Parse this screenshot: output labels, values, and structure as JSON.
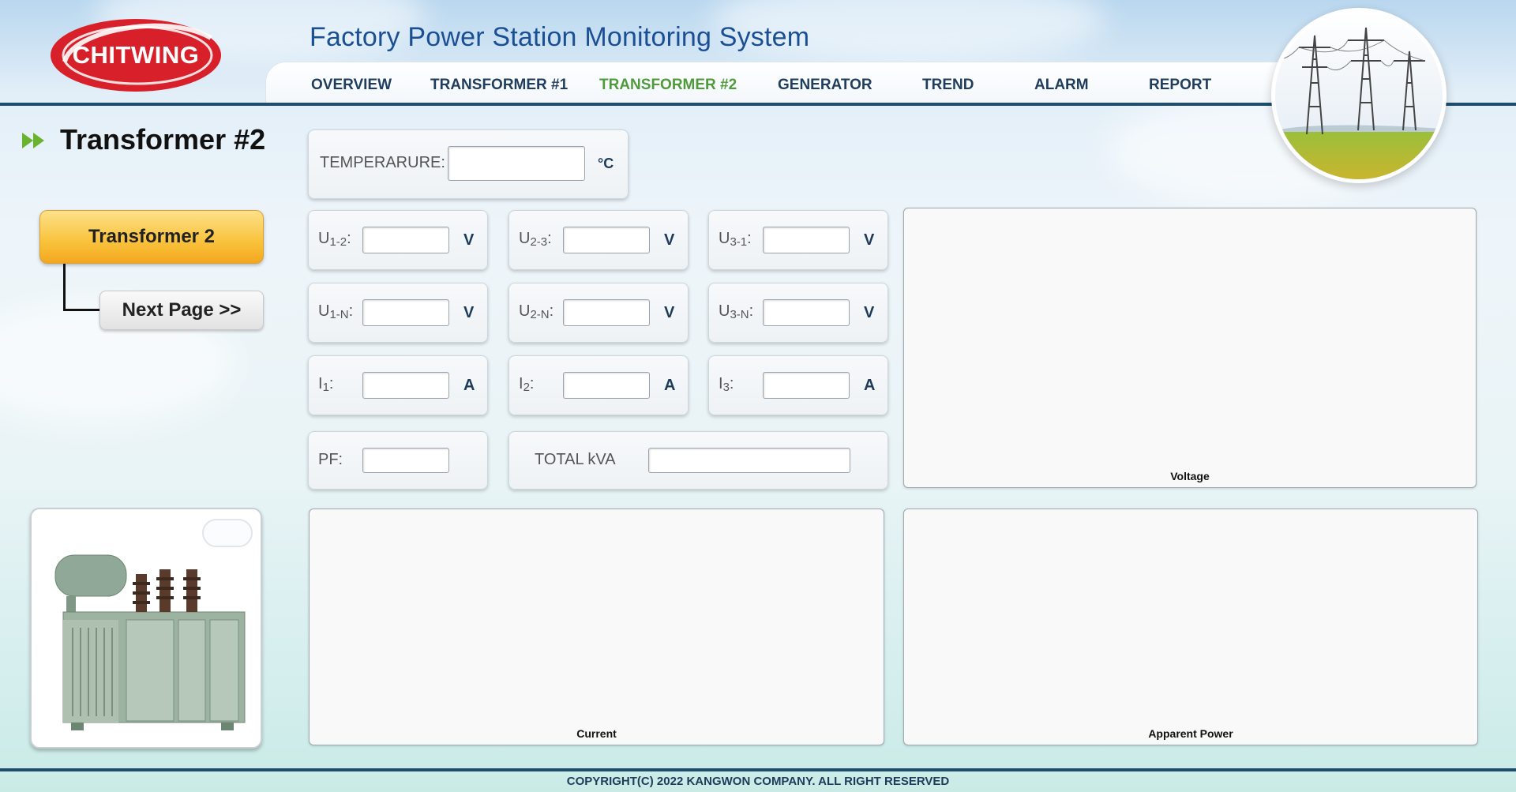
{
  "brand": {
    "logo_text": "CHITWING",
    "logo_color": "#d8202a"
  },
  "header": {
    "title": "Factory Power Station Monitoring System"
  },
  "nav": {
    "items": [
      {
        "label": "OVERVIEW"
      },
      {
        "label": "TRANSFORMER #1"
      },
      {
        "label": "TRANSFORMER #2",
        "active": true
      },
      {
        "label": "GENERATOR"
      },
      {
        "label": "TREND"
      },
      {
        "label": "ALARM"
      },
      {
        "label": "REPORT"
      }
    ],
    "active_color": "#4f9a3c"
  },
  "page": {
    "title": "Transformer #2",
    "transformer_button": "Transformer 2",
    "next_button": "Next Page >>"
  },
  "readings": {
    "temperature": {
      "label": "TEMPERARURE:",
      "unit": "°C",
      "value": ""
    },
    "u12": {
      "label_main": "U",
      "label_sub": "1-2",
      "label_suffix": ":",
      "unit": "V",
      "value": ""
    },
    "u23": {
      "label_main": "U",
      "label_sub": "2-3",
      "label_suffix": ":",
      "unit": "V",
      "value": ""
    },
    "u31": {
      "label_main": "U",
      "label_sub": "3-1",
      "label_suffix": ":",
      "unit": "V",
      "value": ""
    },
    "u1n": {
      "label_main": "U",
      "label_sub": "1-N",
      "label_suffix": ":",
      "unit": "V",
      "value": ""
    },
    "u2n": {
      "label_main": "U",
      "label_sub": "2-N",
      "label_suffix": ":",
      "unit": "V",
      "value": ""
    },
    "u3n": {
      "label_main": "U",
      "label_sub": "3-N",
      "label_suffix": ":",
      "unit": "V",
      "value": ""
    },
    "i1": {
      "label_main": "I",
      "label_sub": "1",
      "label_suffix": ":",
      "unit": "A",
      "value": ""
    },
    "i2": {
      "label_main": "I",
      "label_sub": "2",
      "label_suffix": ":",
      "unit": "A",
      "value": ""
    },
    "i3": {
      "label_main": "I",
      "label_sub": "3",
      "label_suffix": ":",
      "unit": "A",
      "value": ""
    },
    "pf": {
      "label": "PF:",
      "value": ""
    },
    "total_kva": {
      "label": "TOTAL kVA",
      "value": ""
    }
  },
  "charts": {
    "voltage": "Voltage",
    "current": "Current",
    "apparent_power": "Apparent Power"
  },
  "footer": {
    "copyright": "COPYRIGHT(C) 2022 KANGWON COMPANY. ALL RIGHT RESERVED"
  }
}
